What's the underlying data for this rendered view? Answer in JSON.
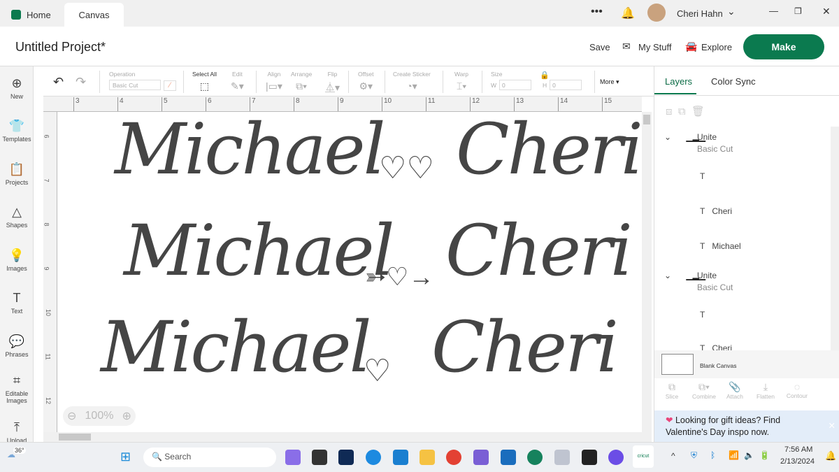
{
  "tabs": [
    {
      "label": "Home"
    },
    {
      "label": "Canvas"
    }
  ],
  "titlebar": {
    "user": "Cheri Hahn"
  },
  "header": {
    "title": "Untitled Project*",
    "save": "Save",
    "my_stuff": "My Stuff",
    "explore": "Explore",
    "make": "Make"
  },
  "colors": {
    "brand": "#0b7a4f",
    "accent_text": "#0b6b45"
  },
  "sidebar": [
    {
      "label": "New",
      "icon": "plus-circle-icon"
    },
    {
      "label": "Templates",
      "icon": "shirt-icon"
    },
    {
      "label": "Projects",
      "icon": "clipboard-icon"
    },
    {
      "label": "Shapes",
      "icon": "shapes-icon"
    },
    {
      "label": "Images",
      "icon": "bulb-icon"
    },
    {
      "label": "Text",
      "icon": "text-icon"
    },
    {
      "label": "Phrases",
      "icon": "chat-icon"
    },
    {
      "label": "Editable Images",
      "icon": "editable-icon"
    },
    {
      "label": "Upload",
      "icon": "upload-icon"
    }
  ],
  "toolbar": {
    "operation": "Operation",
    "operation_value": "Basic Cut",
    "select_all": "Select All",
    "edit": "Edit",
    "align": "Align",
    "arrange": "Arrange",
    "flip": "Flip",
    "offset": "Offset",
    "create_sticker": "Create Sticker",
    "warp": "Warp",
    "size": "Size",
    "w_label": "W",
    "w_value": "0",
    "h_label": "H",
    "h_value": "0",
    "more": "More"
  },
  "ruler": {
    "h": [
      "3",
      "4",
      "5",
      "6",
      "7",
      "8",
      "9",
      "10",
      "11",
      "12",
      "13",
      "14",
      "15"
    ],
    "v": [
      "6",
      "7",
      "8",
      "9",
      "10",
      "11",
      "12"
    ]
  },
  "canvas": {
    "rows": [
      {
        "left": "Michael",
        "right": "Cheri"
      },
      {
        "left": "Michael",
        "right": "Cheri"
      },
      {
        "left": "Michael",
        "right": "Cheri"
      }
    ],
    "zoom": "100%"
  },
  "panel": {
    "tabs": [
      "Layers",
      "Color Sync"
    ],
    "layers": [
      {
        "name": "Unite",
        "sub": "Basic Cut"
      },
      {
        "name": "",
        "type": "T"
      },
      {
        "name": "Cheri",
        "type": "T"
      },
      {
        "name": "Michael",
        "type": "T"
      },
      {
        "name": "Unite",
        "sub": "Basic Cut"
      },
      {
        "name": "",
        "type": "T"
      },
      {
        "name": "Cheri",
        "type": "T"
      }
    ],
    "blank_canvas": "Blank Canvas",
    "actions": [
      "Slice",
      "Combine",
      "Attach",
      "Flatten",
      "Contour"
    ],
    "promo": "Looking for gift ideas? Find Valentine's Day inspo now."
  },
  "taskbar": {
    "weather": "36°",
    "search": "Search",
    "time": "7:56 AM",
    "date": "2/13/2024",
    "cricut": "cricut"
  }
}
